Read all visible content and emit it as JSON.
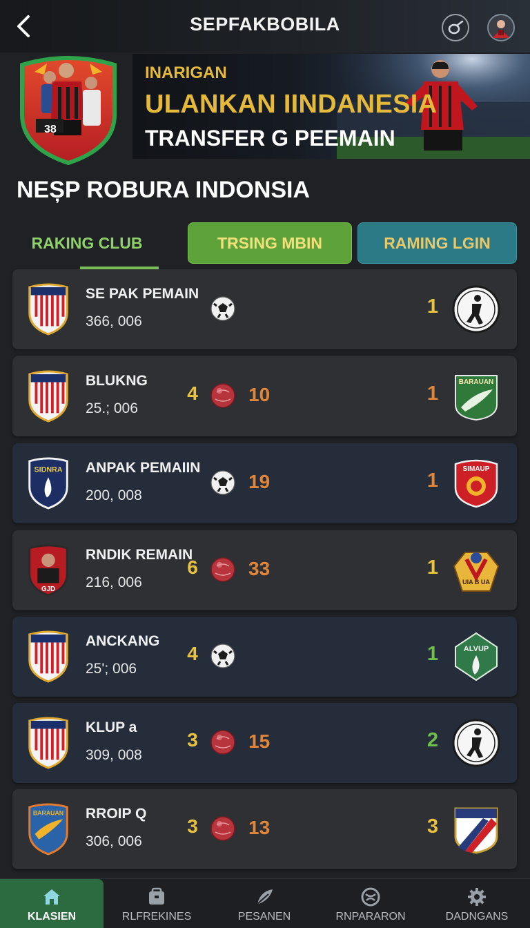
{
  "header": {
    "title": "SEPFAKBOBILA",
    "back_icon": "chevron-left-icon",
    "share_icon": "whistle-icon",
    "avatar_icon": "avatar-icon"
  },
  "hero": {
    "kicker": "INARIGAN",
    "headline": "ULANKAN IINDANESIA",
    "subtitle": "TRANSFER G PEEMAIN",
    "crest_number": "38"
  },
  "section": {
    "title": "NEȘP ROBURA INDONSIA"
  },
  "tabs": [
    {
      "label": "RAKING CLUB",
      "active": true
    },
    {
      "label": "TRSING MBIN",
      "active": false
    },
    {
      "label": "RAMING LGIN",
      "active": false
    }
  ],
  "rows": [
    {
      "name": "SE PAK PEMAIN",
      "value": "366, 006",
      "rank": "",
      "ball": "white",
      "goals": "",
      "pos": "1",
      "pos_color": "#e9c23e",
      "crest": "stripes",
      "logo": "player-white"
    },
    {
      "name": "BLUKNG",
      "value": "25.; 006",
      "rank": "4",
      "ball": "red",
      "goals": "10",
      "pos": "1",
      "pos_color": "#e0863a",
      "crest": "stripes",
      "logo": "green-bird",
      "logo_text": "BARAUAN"
    },
    {
      "name": "ANPAK PEMAIIN",
      "value": "200, 008",
      "rank": "",
      "ball": "white",
      "goals": "19",
      "pos": "1",
      "pos_color": "#e0863a",
      "crest": "blue-shield",
      "crest_text": "SIDNRA",
      "logo": "red-shield",
      "logo_text": "SIMAUP"
    },
    {
      "name": "RNDIK REMAIN",
      "value": "216, 006",
      "rank": "6",
      "ball": "red",
      "goals": "33",
      "pos": "1",
      "pos_color": "#e9c23e",
      "crest": "player-shield",
      "crest_text": "GJD",
      "logo": "gold-badge",
      "logo_text": "UIA B UA"
    },
    {
      "name": "ANCKANG",
      "value": "25'; 006",
      "rank": "4",
      "ball": "white",
      "goals": "",
      "pos": "1",
      "pos_color": "#6fbf4a",
      "crest": "stripes",
      "logo": "green-emblem",
      "logo_text": "ALVUP"
    },
    {
      "name": "KLUP a",
      "value": "309, 008",
      "rank": "3",
      "ball": "red",
      "goals": "15",
      "pos": "2",
      "pos_color": "#6fbf4a",
      "crest": "stripes",
      "logo": "player-white"
    },
    {
      "name": "RROIP Q",
      "value": "306, 006",
      "rank": "3",
      "ball": "red",
      "goals": "13",
      "pos": "3",
      "pos_color": "#e9c23e",
      "crest": "blue-bird",
      "crest_text": "BARAUAN",
      "logo": "flag-shield"
    }
  ],
  "nav": [
    {
      "label": "KLASIEN",
      "icon": "home-icon",
      "active": true
    },
    {
      "label": "RLFREKINES",
      "icon": "calendar-icon",
      "active": false
    },
    {
      "label": "PESANEN",
      "icon": "feather-icon",
      "active": false
    },
    {
      "label": "RNPARARON",
      "icon": "ball-icon",
      "active": false
    },
    {
      "label": "DADNGANS",
      "icon": "gear-icon",
      "active": false
    }
  ],
  "colors": {
    "background": "#1f2124",
    "gold": "#e9c23e",
    "orange": "#e0863a",
    "green": "#6fbf4a",
    "tab_green": "#5ea33a",
    "tab_teal": "#2b7a86"
  }
}
